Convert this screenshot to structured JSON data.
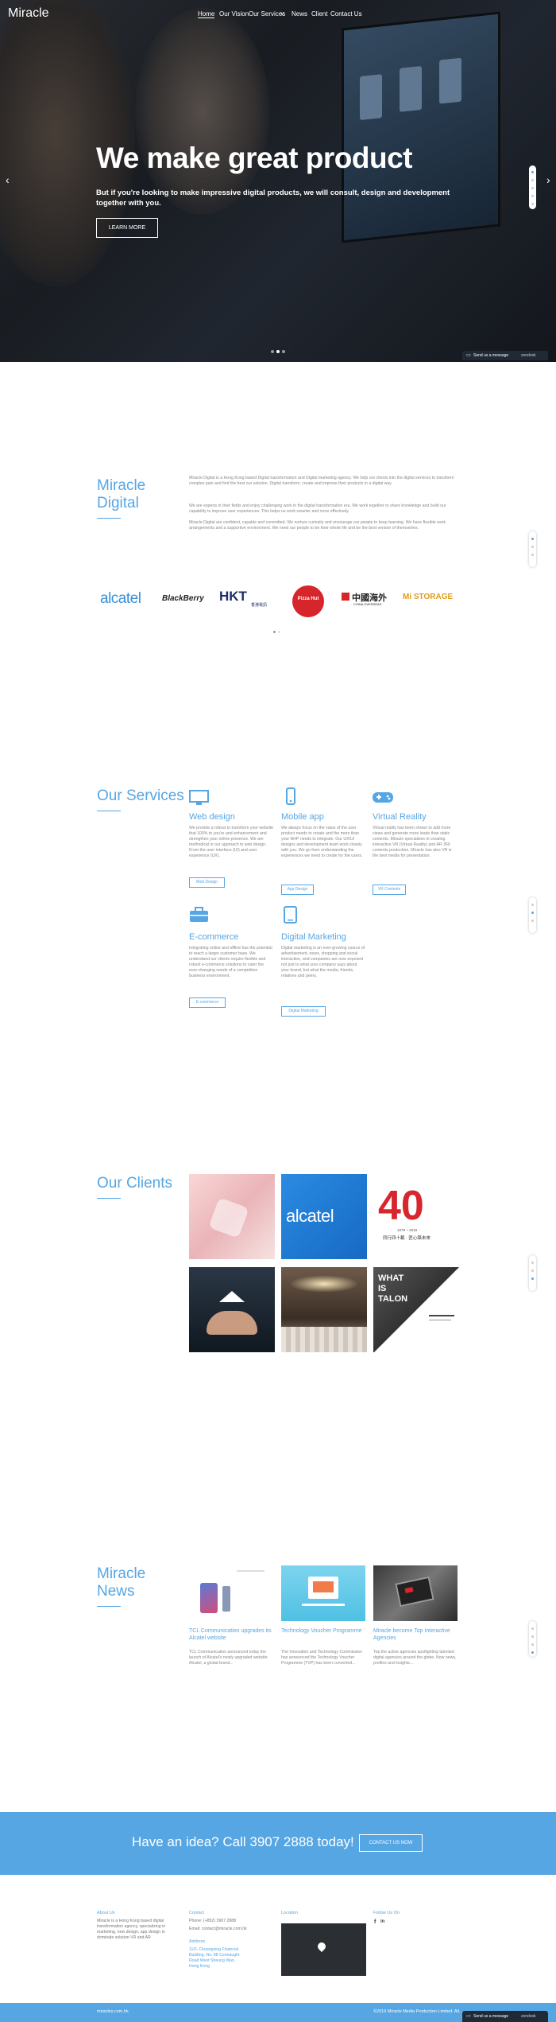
{
  "brand": {
    "logo": "Miracle"
  },
  "nav": {
    "items": [
      "Home",
      "Our Vision",
      "Our Services",
      "News",
      "Client",
      "Contact Us"
    ],
    "dropdown_caret": "˅"
  },
  "hero": {
    "title": "We make great product",
    "subtitle": "But if you're looking to make impressive digital products, we will consult, design and development together with you.",
    "button": "LEARN MORE",
    "prev": "‹",
    "next": "›"
  },
  "chat": {
    "label": "Send us a message",
    "brand": "zendesk"
  },
  "about": {
    "title_line1": "Miracle",
    "title_line2": "Digital",
    "paragraphs": [
      "Miracle Digital is a Hong Kong based Digital transformation and Digital marketing agency. We help our clients into the digital services to transform complex pain and find the best our solution. Digital transform, create and improve their products in a digital way.",
      "We are experts in their fields and enjoy challenging work in the digital transformation era. We work together to share knowledge and build our capability to improve user experiences. This helps us work smarter and more effectively.",
      "Miracle Digital are confident, capable and committed. We nurture curiosity and encourage our people to keep learning. We have flexible work arrangements and a supportive environment. We need our people to be their whole life and be the best version of themselves."
    ],
    "logos": [
      "alcatel",
      "BlackBerry",
      "HKT",
      "Pizza Hut",
      "中國海外",
      "Mi STORAGE"
    ],
    "logo_subtext": {
      "hkt": "香港電訊",
      "coli": "CHINA OVERSEAS"
    }
  },
  "services": {
    "title": "Our Services",
    "items": [
      {
        "icon": "monitor-icon",
        "title": "Web design",
        "text": "We provide a robust to transform your website that 100% to you're and enhancement and strengthen your online presence. We are methodical in our approach to web design. From the user interface (UI) and user experience (UX).",
        "button": "Web Design"
      },
      {
        "icon": "mobile-icon",
        "title": "Mobile app",
        "text": "We always focus on the value of the user product needs to create and the more than your NHP needs to integrate. Our UX/UI designs and development team work closely with you. We go from understanding the experiences we need to create for the users.",
        "button": "App Design"
      },
      {
        "icon": "gamepad-icon",
        "title": "Virtual Reality",
        "text": "Virtual reality has been shown to add more views and generate more leads than static contents. Miracle specializes in creating interactive VR (Virtual Reality) and AR 360 contents production. Miracle has also VR is the best media for presentation.",
        "button": "VR Contents"
      },
      {
        "icon": "briefcase-icon",
        "title": "E-commerce",
        "text": "Integrating online and offline has the potential to reach a larger customer base. We understand our clients require flexible and robust e-commerce solutions to cater the ever-changing needs of a competitive business environment.",
        "button": "E-commerce"
      },
      {
        "icon": "tablet-icon",
        "title": "Digital Marketing",
        "text": "Digital marketing is an ever-growing source of advertisement, news, shopping and social interaction, and companies are now exposed not just to what your company says about your brand, but what the media, friends, relatives and peers.",
        "button": "Digital Marketing"
      }
    ]
  },
  "clients": {
    "title": "Our Clients",
    "anniversary": {
      "number": "40",
      "years": "1979 ~ 2019",
      "tagline": "同行四十載 · 匠心築未來"
    },
    "alcatel": "alcatel",
    "talon": "WHAT IS TALON"
  },
  "news": {
    "title_line1": "Miracle",
    "title_line2": "News",
    "items": [
      {
        "title": "TCL Communication upgrades its Alcatel website",
        "text": "TCL Communication announced today the launch of Alcatel's newly upgraded website. Alcatel, a global brand..."
      },
      {
        "title": "Technology Voucher Programme",
        "text": "The Innovation and Technology Commission has announced the Technology Voucher Programme (TVP) has been converted..."
      },
      {
        "title": "Miracle become Top Interactive Agencies",
        "text": "Top the active agencies spotlighting talented digital agencies around the globe. Now news, profiles and insights..."
      }
    ]
  },
  "cta": {
    "text": "Have an idea? Call 3907 2888 today!",
    "button": "CONTACT US NOW"
  },
  "footer": {
    "about_title": "About Us",
    "about_text": "Miracle is a Hong Kong based digital transformation agency, specializing in marketing, new design, app design in dominate solution VR and AR",
    "contact_title": "Contact",
    "phone": "Phone: (+852) 3907 2888",
    "email": "Email: contact@miracle.com.hk",
    "address_title": "Address",
    "address": "11/F, Chuangxing Financial Building, No. 88 Connaught Road West Sheung Wan, Hong Kong",
    "location_title": "Location",
    "follow_title": "Follow Us On",
    "social": [
      "f",
      "in"
    ],
    "bar_left": "miracles.com.hk",
    "bar_right": "©2019 Miracle Media Production Limited. All..."
  },
  "colors": {
    "accent": "#56a6e3",
    "cta_bg": "#56a6e3",
    "footer_bar": "#56a6e3"
  }
}
